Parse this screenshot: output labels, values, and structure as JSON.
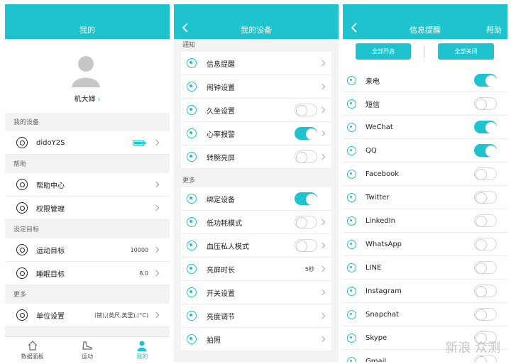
{
  "panel1": {
    "header": {
      "title": "我的"
    },
    "profile": {
      "name": "机大婶"
    },
    "sections": {
      "device": "我的设备",
      "help": "帮助",
      "goals": "设定目标",
      "more": "更多"
    },
    "device_row": {
      "label": "didoY2S"
    },
    "help_rows": [
      {
        "label": "帮助中心"
      },
      {
        "label": "权限管理"
      }
    ],
    "goal_rows": [
      {
        "label": "运动目标",
        "value": "10000"
      },
      {
        "label": "睡眠目标",
        "value": "8.0"
      }
    ],
    "more_rows": [
      {
        "label": "单位设置",
        "value": "(镑),(英尺,英里),(°C)"
      }
    ],
    "tabs": [
      {
        "label": "数据面板",
        "icon": "home-icon"
      },
      {
        "label": "运动",
        "icon": "shoe-icon"
      },
      {
        "label": "我的",
        "icon": "person-icon"
      }
    ]
  },
  "panel2": {
    "header": {
      "title": "我的设备"
    },
    "sections": {
      "notify": "通知",
      "more": "更多"
    },
    "notify_rows": [
      {
        "label": "信息提醒",
        "icon": "message-icon"
      },
      {
        "label": "闹钟设置",
        "icon": "alarm-icon"
      },
      {
        "label": "久坐设置",
        "icon": "sitting-icon",
        "toggle": false
      },
      {
        "label": "心率报警",
        "icon": "heart-icon",
        "toggle": true
      },
      {
        "label": "转腕亮屏",
        "icon": "rotate-icon",
        "toggle": false
      }
    ],
    "more_rows": [
      {
        "label": "绑定设备",
        "icon": "link-icon",
        "toggle": true
      },
      {
        "label": "低功耗模式",
        "icon": "battery-icon",
        "toggle": false
      },
      {
        "label": "血压私人模式",
        "icon": "bloodpressure-icon",
        "toggle": false
      },
      {
        "label": "亮屏时长",
        "icon": "screen-icon",
        "value": "5秒"
      },
      {
        "label": "开关设置",
        "icon": "switch-icon"
      },
      {
        "label": "亮度调节",
        "icon": "brightness-icon"
      },
      {
        "label": "拍照",
        "icon": "camera-icon"
      }
    ]
  },
  "panel3": {
    "header": {
      "title": "信息提醒",
      "help": "帮助"
    },
    "buttons": {
      "all_on": "全部开启",
      "all_off": "全部关闭"
    },
    "apps": [
      {
        "label": "来电",
        "icon": "phone-icon",
        "on": true
      },
      {
        "label": "短信",
        "icon": "sms-icon",
        "on": false
      },
      {
        "label": "WeChat",
        "icon": "wechat-icon",
        "on": true
      },
      {
        "label": "QQ",
        "icon": "qq-icon",
        "on": true
      },
      {
        "label": "Facebook",
        "icon": "facebook-icon",
        "on": false
      },
      {
        "label": "Twitter",
        "icon": "twitter-icon",
        "on": false
      },
      {
        "label": "LinkedIn",
        "icon": "linkedin-icon",
        "on": false
      },
      {
        "label": "WhatsApp",
        "icon": "whatsapp-icon",
        "on": false
      },
      {
        "label": "LINE",
        "icon": "line-icon",
        "on": false
      },
      {
        "label": "Instagram",
        "icon": "instagram-icon",
        "on": false
      },
      {
        "label": "Snapchat",
        "icon": "snapchat-icon",
        "on": false
      },
      {
        "label": "Skype",
        "icon": "skype-icon",
        "on": false
      },
      {
        "label": "Gmail",
        "icon": "gmail-icon",
        "on": false
      }
    ],
    "watermark": "新浪 众测"
  },
  "colors": {
    "accent": "#1ec3cd",
    "background": "#f3f3f3"
  }
}
